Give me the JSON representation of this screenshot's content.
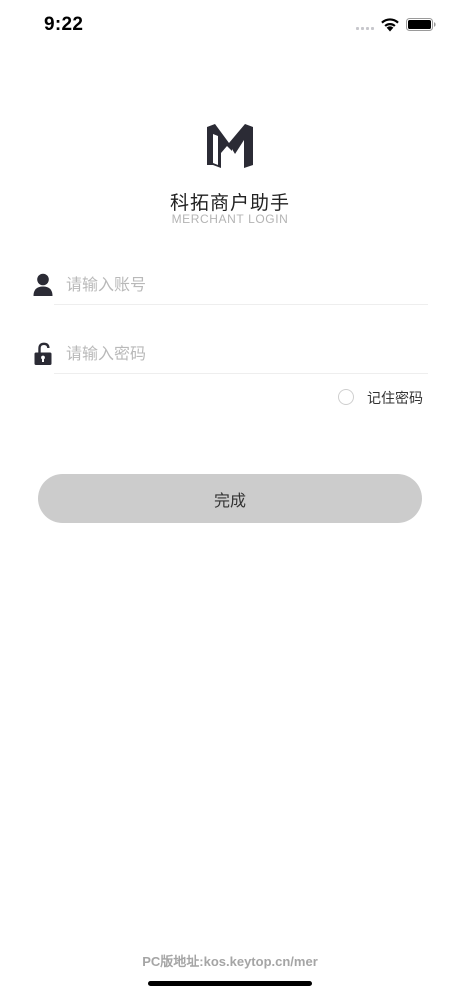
{
  "status_bar": {
    "time": "9:22",
    "signal_icon": "cellular-signal-icon",
    "wifi_icon": "wifi-icon",
    "battery_icon": "battery-icon"
  },
  "header": {
    "logo_icon": "merchant-logo-icon",
    "title": "科拓商户助手",
    "subtitle": "MERCHANT LOGIN"
  },
  "form": {
    "account": {
      "icon": "user-icon",
      "value": "",
      "placeholder": "请输入账号"
    },
    "password": {
      "icon": "unlock-icon",
      "value": "",
      "placeholder": "请输入密码"
    },
    "remember": {
      "label": "记住密码",
      "checked": false
    },
    "submit_label": "完成"
  },
  "footer": {
    "pc_url": "PC版地址:kos.keytop.cn/mer"
  },
  "colors": {
    "button_bg": "#cccccc",
    "placeholder": "#b9b9b9",
    "logo": "#2b2b35",
    "divider": "#eeeeee"
  }
}
